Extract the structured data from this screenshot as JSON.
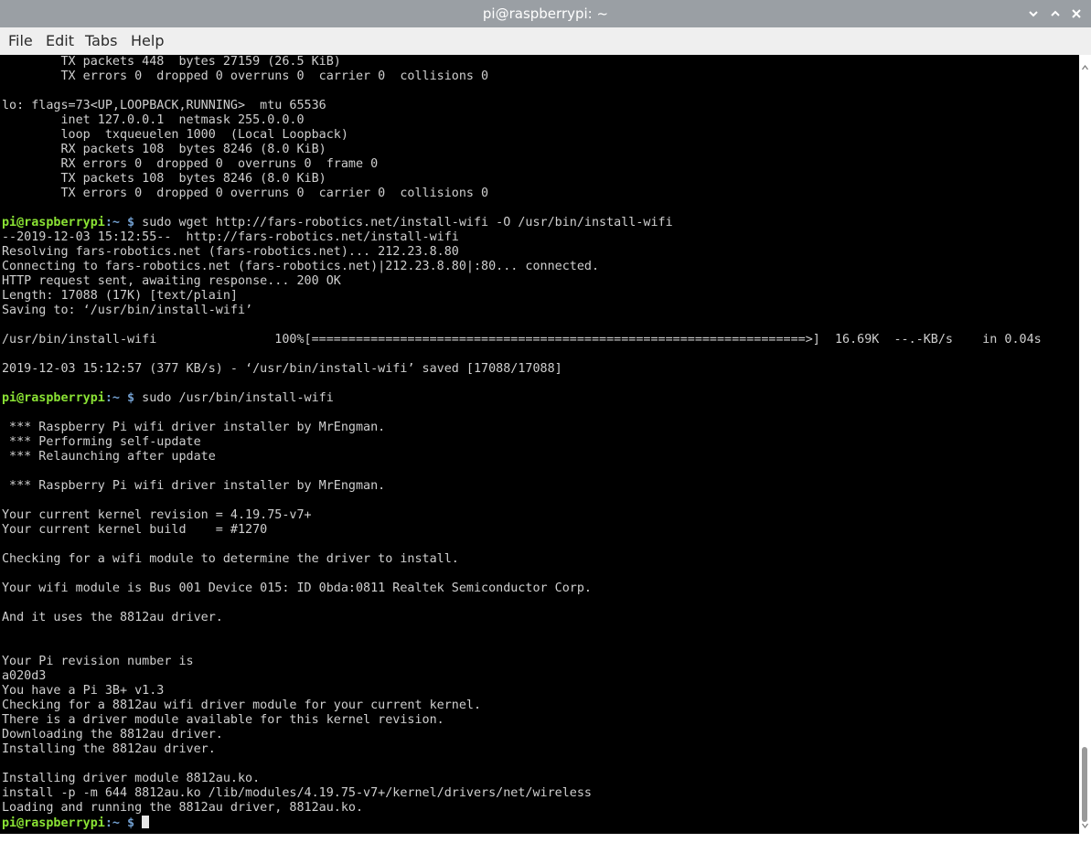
{
  "window": {
    "title": "pi@raspberrypi: ~",
    "buttons": [
      {
        "name": "minimize-button",
        "icon": "chevron-down-icon"
      },
      {
        "name": "maximize-button",
        "icon": "chevron-up-icon"
      },
      {
        "name": "close-button",
        "icon": "close-icon"
      }
    ]
  },
  "menu": [
    "File",
    "Edit",
    "Tabs",
    "Help"
  ],
  "prompt": {
    "user": "pi@raspberrypi",
    "path": ":~ $"
  },
  "terminal": {
    "colors": {
      "background": "#000000",
      "text": "#cfcfcf",
      "user": "#8ae234",
      "path": "#729fcf"
    },
    "lines": [
      "        TX packets 448  bytes 27159 (26.5 KiB)",
      "        TX errors 0  dropped 0 overruns 0  carrier 0  collisions 0",
      "",
      "lo: flags=73<UP,LOOPBACK,RUNNING>  mtu 65536",
      "        inet 127.0.0.1  netmask 255.0.0.0",
      "        loop  txqueuelen 1000  (Local Loopback)",
      "        RX packets 108  bytes 8246 (8.0 KiB)",
      "        RX errors 0  dropped 0  overruns 0  frame 0",
      "        TX packets 108  bytes 8246 (8.0 KiB)",
      "        TX errors 0  dropped 0 overruns 0  carrier 0  collisions 0",
      "",
      " sudo wget http://fars-robotics.net/install-wifi -O /usr/bin/install-wifi",
      "--2019-12-03 15:12:55--  http://fars-robotics.net/install-wifi",
      "Resolving fars-robotics.net (fars-robotics.net)... 212.23.8.80",
      "Connecting to fars-robotics.net (fars-robotics.net)|212.23.8.80|:80... connected.",
      "HTTP request sent, awaiting response... 200 OK",
      "Length: 17088 (17K) [text/plain]",
      "Saving to: ‘/usr/bin/install-wifi’",
      "",
      "/usr/bin/install-wifi                100%[===================================================================>]  16.69K  --.-KB/s    in 0.04s",
      "",
      "2019-12-03 15:12:57 (377 KB/s) - ‘/usr/bin/install-wifi’ saved [17088/17088]",
      "",
      " sudo /usr/bin/install-wifi",
      "",
      " *** Raspberry Pi wifi driver installer by MrEngman.",
      " *** Performing self-update",
      " *** Relaunching after update",
      "",
      " *** Raspberry Pi wifi driver installer by MrEngman.",
      "",
      "Your current kernel revision = 4.19.75-v7+",
      "Your current kernel build    = #1270",
      "",
      "Checking for a wifi module to determine the driver to install.",
      "",
      "Your wifi module is Bus 001 Device 015: ID 0bda:0811 Realtek Semiconductor Corp.",
      "",
      "And it uses the 8812au driver.",
      "",
      "",
      "Your Pi revision number is",
      "a020d3",
      "You have a Pi 3B+ v1.3",
      "Checking for a 8812au wifi driver module for your current kernel.",
      "There is a driver module available for this kernel revision.",
      "Downloading the 8812au driver.",
      "Installing the 8812au driver.",
      "",
      "Installing driver module 8812au.ko.",
      "install -p -m 644 8812au.ko /lib/modules/4.19.75-v7+/kernel/drivers/net/wireless",
      "Loading and running the 8812au driver, 8812au.ko.",
      ""
    ]
  }
}
